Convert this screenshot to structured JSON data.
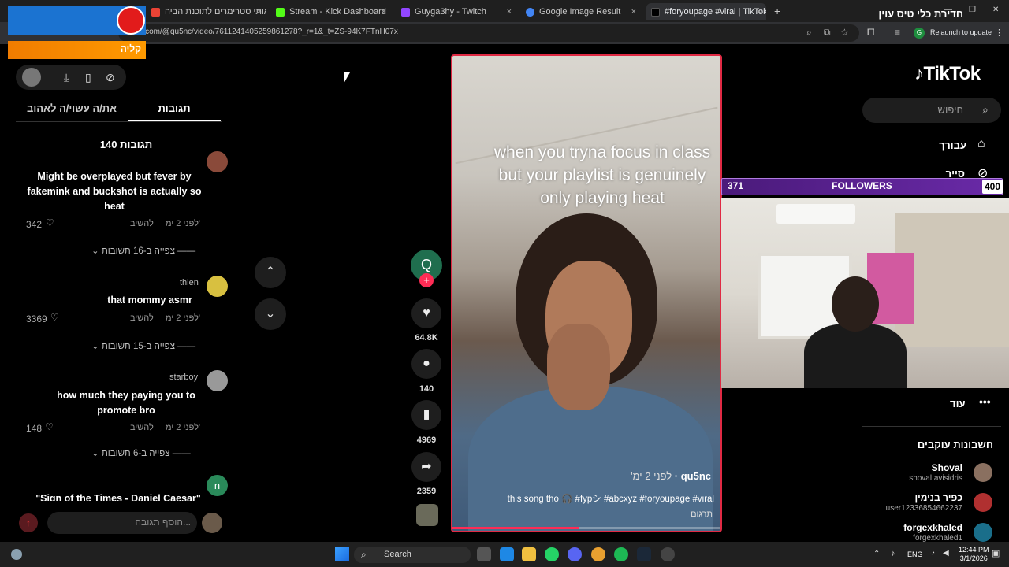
{
  "browser": {
    "tabs": [
      {
        "label": "הבאותי סטרימרים לתוכנת הביה",
        "close": "×",
        "color": "#ea4335"
      },
      {
        "label": "Stream - Kick Dashboard",
        "close": "×",
        "color": "#53fc18"
      },
      {
        "label": "Guyga3hy - Twitch",
        "close": "×",
        "color": "#9146ff"
      },
      {
        "label": "Google Image Result",
        "close": "×",
        "color": "#4285f4"
      },
      {
        "label": "#foryoupage #viral | TikTok",
        "close": "×",
        "color": "#000000"
      }
    ],
    "new_tab": "+",
    "url": "tiktok.com/@qu5nc/video/7611241405259861278?_r=1&_t=ZS-94K7FTnH07x",
    "relaunch_label": "Relaunch to update",
    "profile_initial": "G",
    "window_controls": {
      "minimize": "—",
      "maximize": "❐",
      "close": "✕"
    }
  },
  "overlays": {
    "news_text": "חדירת כלי טיס עוין",
    "alert_text": "קליה"
  },
  "comments_panel": {
    "tab_comments": "תגובות",
    "tab_you_may_like": "את/ה עשוי/ה לאהוב",
    "count_label": "140 תגובות",
    "comments": [
      {
        "user": "",
        "text": "Might be overplayed but fever by fakemink and buckshot is actually so heat",
        "time": "לפני 2 ימ'",
        "reply": "להשיב",
        "likes": "342",
        "replies_label": "צפייה ב-16 תשובות"
      },
      {
        "user": "thien",
        "text": "that mommy asmr",
        "time": "לפני 2 ימ'",
        "reply": "להשיב",
        "likes": "3369",
        "replies_label": "צפייה ב-15 תשובות"
      },
      {
        "user": "starboy",
        "text": "how much they paying you to promote bro",
        "time": "לפני 2 ימ'",
        "reply": "להשיב",
        "likes": "148",
        "replies_label": "צפייה ב-6 תשובות"
      },
      {
        "user": "",
        "text": "\"Sign of the Times - Daniel Caesar\"",
        "time": "",
        "reply": "",
        "likes": "",
        "replies_label": ""
      }
    ],
    "fourth_avatar_initial": "n",
    "input_placeholder": "הוסף תגובה...",
    "mention_symbol": "@"
  },
  "video": {
    "caption": "when you tryna focus in class but your playlist is genuinely only playing heat",
    "username": "qu5nc",
    "posted": "לפני 2 ימ'",
    "description": "this song tho 🎧 #fypシ #abcxyz #foryoupage #viral",
    "translate": "תרגום",
    "progress": 0.47
  },
  "actions": {
    "creator_initial": "Q",
    "follow_plus": "+",
    "likes": "64.8K",
    "comments": "140",
    "saves": "4969",
    "shares": "2359"
  },
  "tiktok_sidebar": {
    "logo": "TikTok",
    "search_placeholder": "חיפוש",
    "nav": [
      {
        "label": "עבורך",
        "icon": "home-icon"
      },
      {
        "label": "סייר",
        "icon": "compass-icon"
      }
    ],
    "more_label": "עוד",
    "following_title": "חשבונות עוקבים",
    "following": [
      {
        "name": "Shoval",
        "handle": "shoval.avisidris",
        "color": "#8a7060"
      },
      {
        "name": "כפיר בנימין",
        "handle": "user12336854662237",
        "color": "#b03030"
      },
      {
        "name": "forgexkhaled",
        "handle": "forgexkhaled1",
        "color": "#1a6e8a"
      }
    ]
  },
  "stream_overlay": {
    "followers_current": "371",
    "followers_label": "FOLLOWERS",
    "followers_goal": "400"
  },
  "taskbar": {
    "search_label": "Search",
    "language": "ENG",
    "time": "12:44 PM",
    "date": "3/1/2026"
  }
}
